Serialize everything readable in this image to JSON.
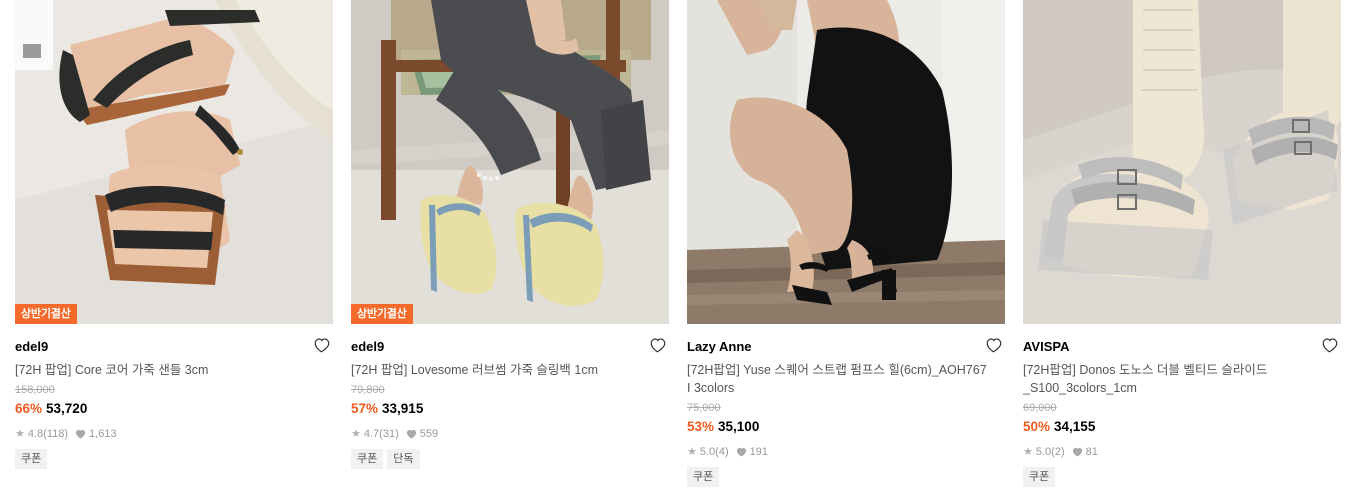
{
  "products": [
    {
      "brand": "edel9",
      "name": "[72H 팝업] Core 코어 가죽 샌들 3cm",
      "badge": "상반기결산",
      "original_price": "158,000",
      "discount": "66%",
      "sale_price": "53,720",
      "rating": "4.8",
      "review_count": "(118)",
      "likes": "1,613",
      "tags": [
        "쿠폰"
      ]
    },
    {
      "brand": "edel9",
      "name": "[72H 팝업] Lovesome 러브썸 가죽 슬링백 1cm",
      "badge": "상반기결산",
      "original_price": "79,800",
      "discount": "57%",
      "sale_price": "33,915",
      "rating": "4.7",
      "review_count": "(31)",
      "likes": "559",
      "tags": [
        "쿠폰",
        "단독"
      ]
    },
    {
      "brand": "Lazy Anne",
      "name": "[72H팝업] Yuse 스퀘어 스트랩 펌프스 힐(6cm)_AOH767 I 3colors",
      "badge": "",
      "original_price": "75,000",
      "discount": "53%",
      "sale_price": "35,100",
      "rating": "5.0",
      "review_count": "(4)",
      "likes": "191",
      "tags": [
        "쿠폰"
      ]
    },
    {
      "brand": "AVISPA",
      "name": "[72H팝업] Donos 도노스 더블 벨티드 슬라이드 _S100_3colors_1cm",
      "badge": "",
      "original_price": "69,000",
      "discount": "50%",
      "sale_price": "34,155",
      "rating": "5.0",
      "review_count": "(2)",
      "likes": "81",
      "tags": [
        "쿠폰"
      ]
    }
  ],
  "icons": {
    "wishlist": "heart-outline-icon",
    "rating": "star-icon",
    "likes": "heart-icon"
  },
  "colors": {
    "badge": "#f56a2b",
    "discount": "#f35a1e",
    "tag_bg": "#f1f1f1"
  }
}
